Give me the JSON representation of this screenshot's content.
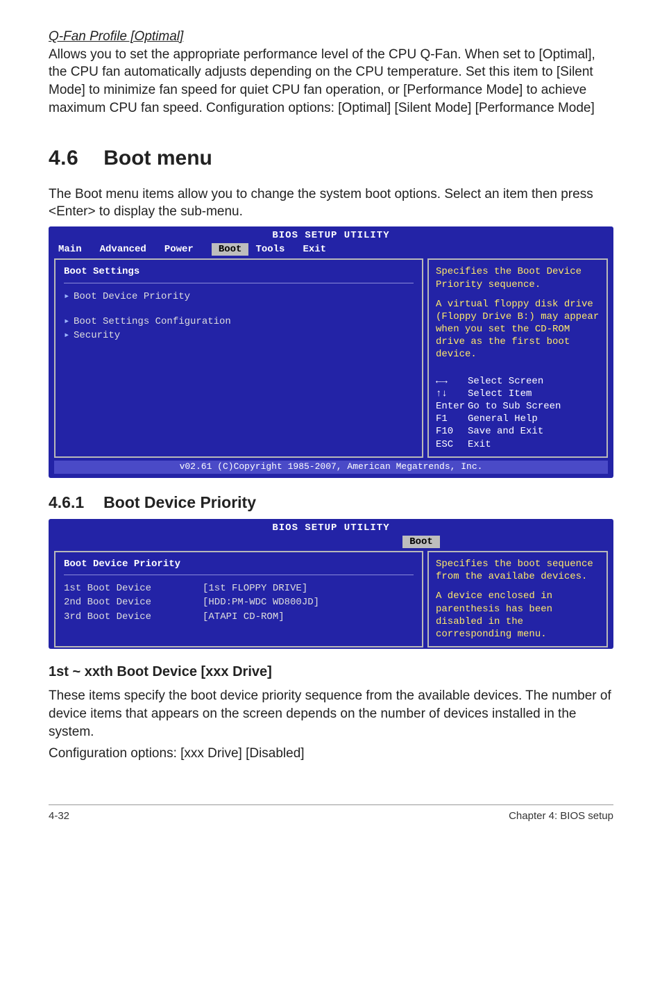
{
  "qfan": {
    "heading": "Q-Fan Profile [Optimal]",
    "para": "Allows you to set the appropriate performance level of the CPU Q-Fan. When set to [Optimal], the CPU fan automatically adjusts depending on the CPU temperature. Set this item to [Silent Mode] to minimize fan speed for quiet CPU fan operation, or [Performance Mode] to achieve maximum CPU fan speed. Configuration options: [Optimal] [Silent Mode] [Performance Mode]"
  },
  "section": {
    "num": "4.6",
    "title": "Boot menu"
  },
  "section_intro": "The Boot menu items allow you to change the system boot options. Select an item then press <Enter> to display the sub-menu.",
  "bios1": {
    "util_title": "BIOS SETUP UTILITY",
    "tabs": {
      "main": "Main",
      "advanced": "Advanced",
      "power": "Power",
      "boot": "Boot",
      "tools": "Tools",
      "exit": "Exit"
    },
    "left": {
      "heading": "Boot Settings",
      "items": {
        "priority": "Boot Device Priority",
        "config": "Boot Settings Configuration",
        "security": "Security"
      }
    },
    "help_top": "Specifies the Boot Device Priority sequence.",
    "help_body": "A virtual floppy disk drive (Floppy Drive B:) may appear when you set the CD-ROM drive as the first boot device.",
    "keys": {
      "arrows_lr": "←→",
      "select_screen": "Select Screen",
      "arrows_ud": "↑↓",
      "select_item": "Select Item",
      "enter": "Enter",
      "go_sub": "Go to Sub Screen",
      "f1": "F1",
      "general_help": "General Help",
      "f10": "F10",
      "save_exit": "Save and Exit",
      "esc": "ESC",
      "exit": "Exit"
    },
    "footer": "v02.61 (C)Copyright 1985-2007, American Megatrends, Inc."
  },
  "sub": {
    "num": "4.6.1",
    "title": "Boot Device Priority"
  },
  "bios2": {
    "util_title": "BIOS SETUP UTILITY",
    "tab": "Boot",
    "left_heading": "Boot Device Priority",
    "rows": {
      "r1l": "1st Boot Device",
      "r1v": "[1st FLOPPY DRIVE]",
      "r2l": "2nd Boot Device",
      "r2v": "[HDD:PM-WDC WD800JD]",
      "r3l": "3rd Boot Device",
      "r3v": "[ATAPI CD-ROM]"
    },
    "help": "Specifies the boot sequence from the availabe devices.",
    "help2": "A device enclosed in parenthesis has been disabled in the corresponding menu."
  },
  "h3": "1st ~ xxth Boot Device [xxx Drive]",
  "desc1": "These items specify the boot device priority sequence from the available devices. The number of device items that appears on the screen depends on the number of devices installed in the system.",
  "desc2": "Configuration options: [xxx Drive] [Disabled]",
  "footer": {
    "left": "4-32",
    "right": "Chapter 4: BIOS setup"
  }
}
